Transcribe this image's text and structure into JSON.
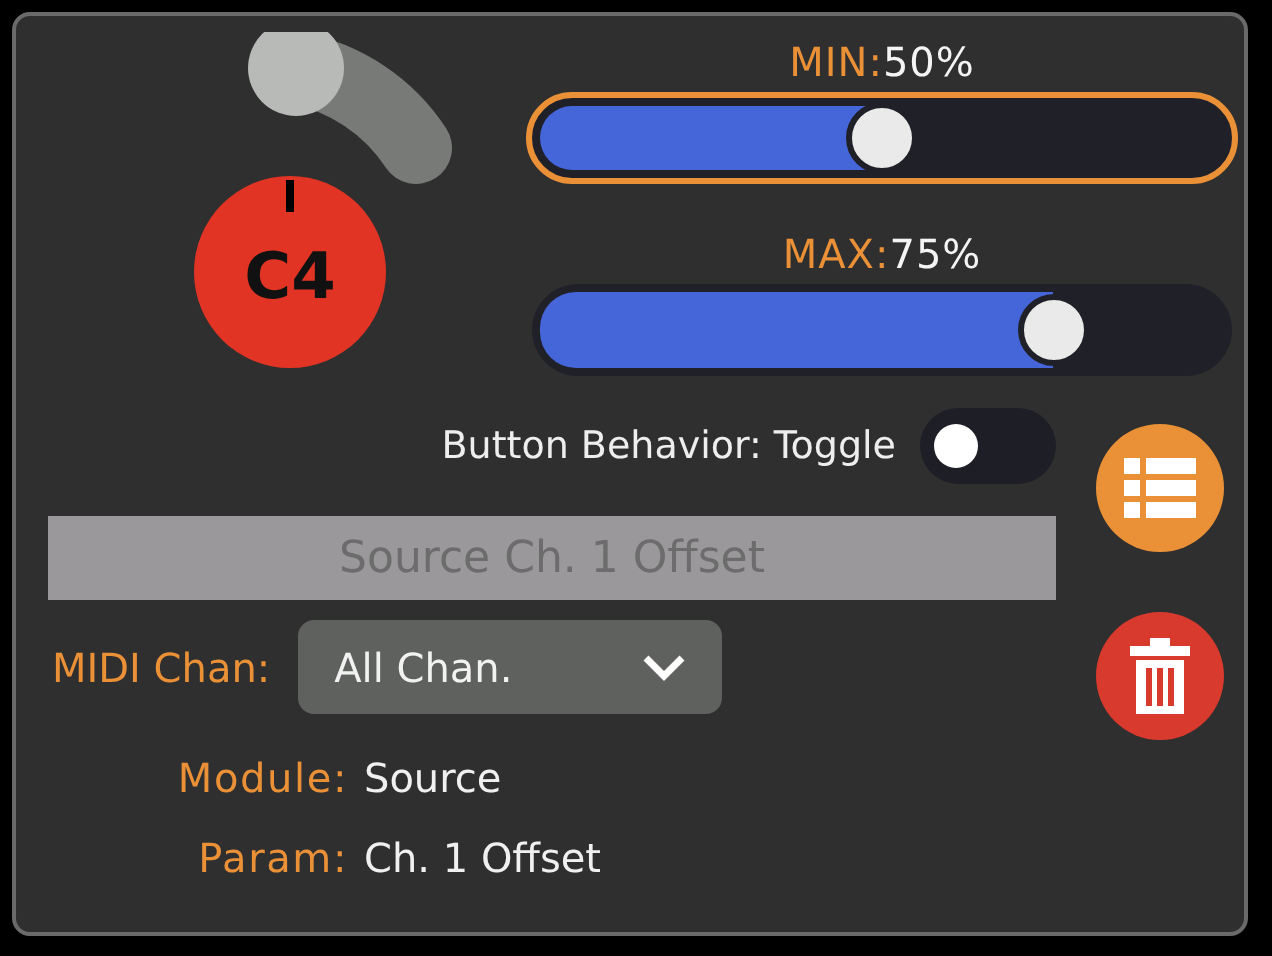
{
  "knob": {
    "note": "C4"
  },
  "sliders": [
    {
      "label": "MIN:",
      "reading": "50%",
      "level": 0.5,
      "focused": true
    },
    {
      "label": "MAX:",
      "reading": "75%",
      "level": 0.75,
      "focused": false
    }
  ],
  "behavior": {
    "label": "Button Behavior: Toggle",
    "on": false
  },
  "name_field": {
    "value": "Source Ch. 1 Offset",
    "disabled": true
  },
  "midi_channel": {
    "label": "MIDI Chan:",
    "value": "All Chan."
  },
  "info": [
    {
      "label": "Module:",
      "value": "Source"
    },
    {
      "label": "Param:",
      "value": "Ch. 1 Offset"
    }
  ]
}
